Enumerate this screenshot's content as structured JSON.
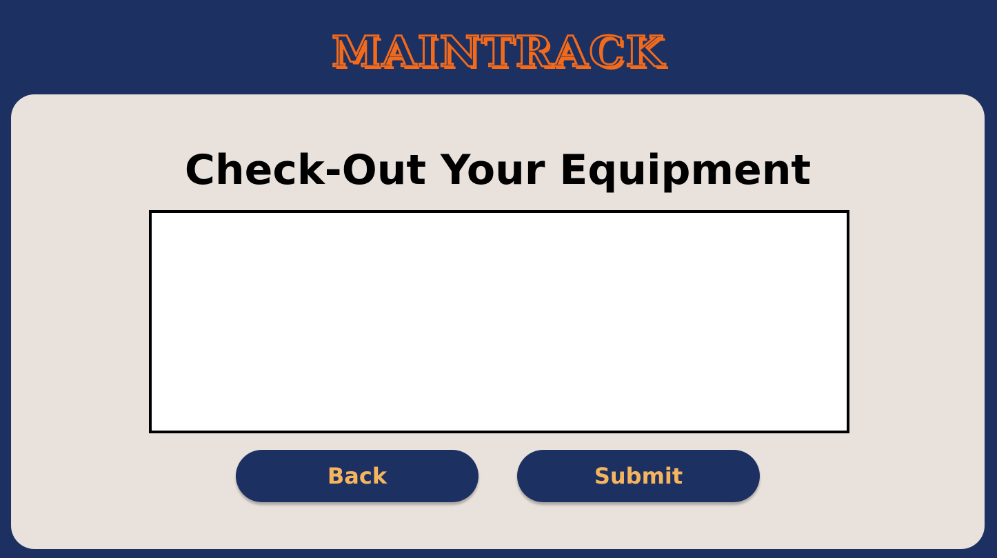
{
  "header": {
    "logo_text": "MAINTRACK"
  },
  "main": {
    "title": "Check-Out Your Equipment",
    "entry_value": "",
    "back_label": "Back",
    "submit_label": "Submit"
  },
  "colors": {
    "background": "#1d3062",
    "card": "#e8e1dc",
    "logo_accent": "#f26a1b",
    "button_text": "#f5b45e",
    "button_bg": "#1d3062"
  }
}
